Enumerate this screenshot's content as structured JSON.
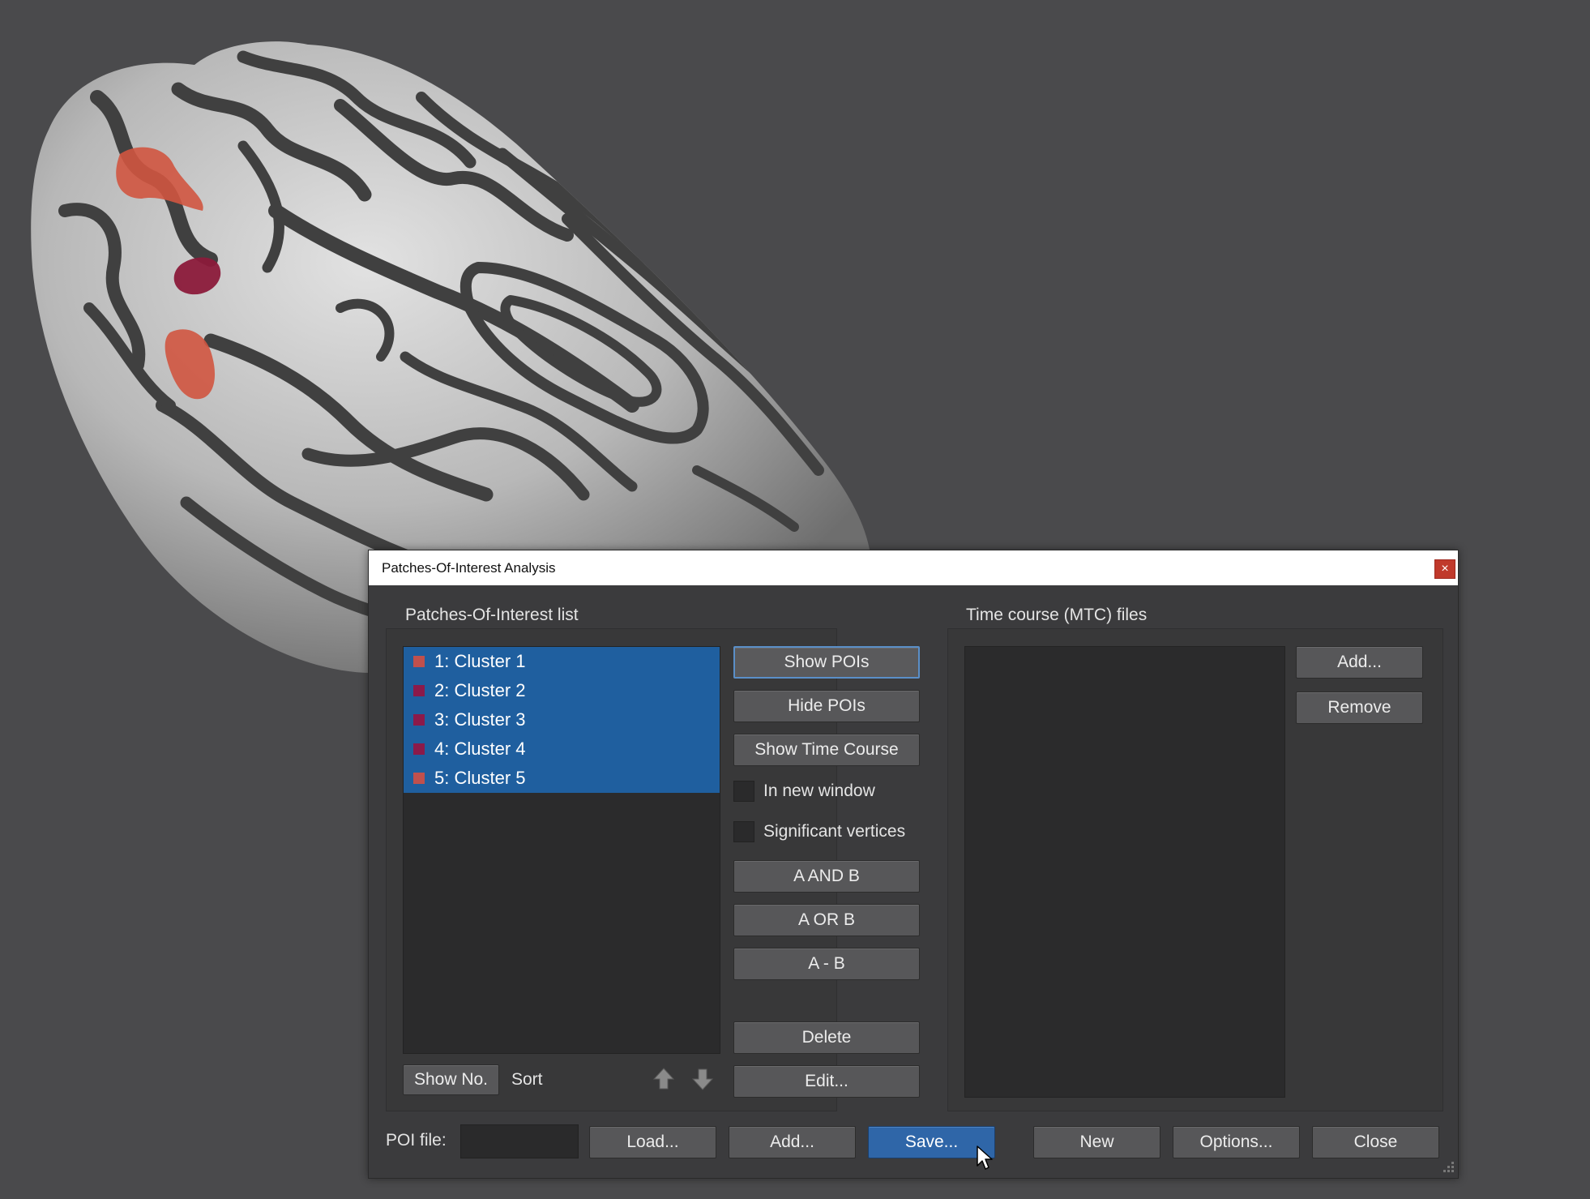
{
  "dialog": {
    "title": "Patches-Of-Interest Analysis",
    "close_glyph": "×"
  },
  "poi_group": {
    "title": "Patches-Of-Interest list",
    "items": [
      {
        "label": "1: Cluster 1",
        "color": "#c0504d"
      },
      {
        "label": "2: Cluster 2",
        "color": "#8b1a4a"
      },
      {
        "label": "3: Cluster 3",
        "color": "#8b1a4a"
      },
      {
        "label": "4: Cluster 4",
        "color": "#8b1a4a"
      },
      {
        "label": "5: Cluster 5",
        "color": "#c0504d"
      }
    ],
    "show_no_label": "Show No.",
    "sort_label": "Sort",
    "move_up_icon": "arrow-up-icon",
    "move_down_icon": "arrow-down-icon"
  },
  "actions": {
    "show_pois": "Show POIs",
    "hide_pois": "Hide POIs",
    "show_time_course": "Show Time Course",
    "in_new_window": "In new window",
    "in_new_window_checked": false,
    "significant_vertices": "Significant vertices",
    "significant_vertices_checked": false,
    "a_and_b": "A AND B",
    "a_or_b": "A OR B",
    "a_minus_b": "A - B",
    "delete": "Delete",
    "edit": "Edit..."
  },
  "mtc_group": {
    "title": "Time course (MTC) files",
    "add": "Add...",
    "remove": "Remove"
  },
  "footer": {
    "poi_file_label": "POI file:",
    "poi_file_value": "",
    "load": "Load...",
    "add": "Add...",
    "save": "Save...",
    "new": "New",
    "options": "Options...",
    "close": "Close"
  },
  "colors": {
    "selection": "#1f5f9f",
    "accent_button": "#2f66a8",
    "background": "#4a4a4c",
    "dialog": "#3b3b3d"
  }
}
